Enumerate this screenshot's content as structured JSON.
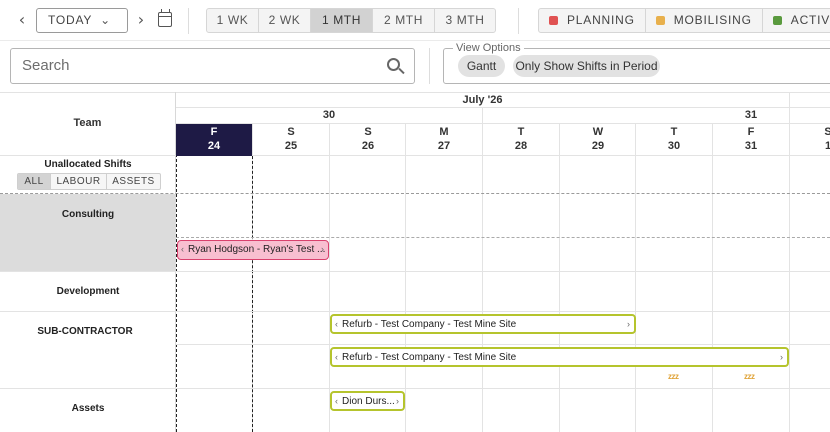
{
  "toolbar": {
    "today_label": "TODAY",
    "ranges": [
      "1 WK",
      "2 WK",
      "1 MTH",
      "2 MTH",
      "3 MTH"
    ],
    "active_range": "1 MTH",
    "statuses": [
      {
        "label": "PLANNING",
        "color": "#e05252"
      },
      {
        "label": "MOBILISING",
        "color": "#e8b04c"
      },
      {
        "label": "ACTIVE",
        "color": "#5a9a3e"
      }
    ]
  },
  "search": {
    "placeholder": "Search"
  },
  "view_options": {
    "legend": "View Options",
    "chips": [
      "Gantt",
      "Only Show Shifts in Period"
    ]
  },
  "calendar": {
    "month_label": "July '26",
    "week_labels": [
      "30",
      "31"
    ],
    "days": [
      {
        "letter": "F",
        "num": "24"
      },
      {
        "letter": "S",
        "num": "25"
      },
      {
        "letter": "S",
        "num": "26"
      },
      {
        "letter": "M",
        "num": "27"
      },
      {
        "letter": "T",
        "num": "28"
      },
      {
        "letter": "W",
        "num": "29"
      },
      {
        "letter": "T",
        "num": "30"
      },
      {
        "letter": "F",
        "num": "31"
      },
      {
        "letter": "S",
        "num": "1"
      }
    ],
    "today_index": 0
  },
  "team_header": "Team",
  "unallocated": {
    "title": "Unallocated Shifts",
    "filters": [
      "ALL",
      "LABOUR",
      "ASSETS"
    ],
    "active_filter": "ALL"
  },
  "groups": [
    "Consulting",
    "Development",
    "SUB-CONTRACTOR",
    "Assets"
  ],
  "shifts": [
    {
      "label": "Ryan Hodgson - Ryan's Test ...",
      "color": "#f8bfd0"
    },
    {
      "label": "Refurb - Test Company - Test Mine Site",
      "color": "#b5c42d"
    },
    {
      "label": "Refurb - Test Company - Test Mine Site",
      "color": "#b5c42d"
    },
    {
      "label": "Dion Durs...",
      "color": "#b5c42d"
    }
  ],
  "zzz_marker": "zzz"
}
